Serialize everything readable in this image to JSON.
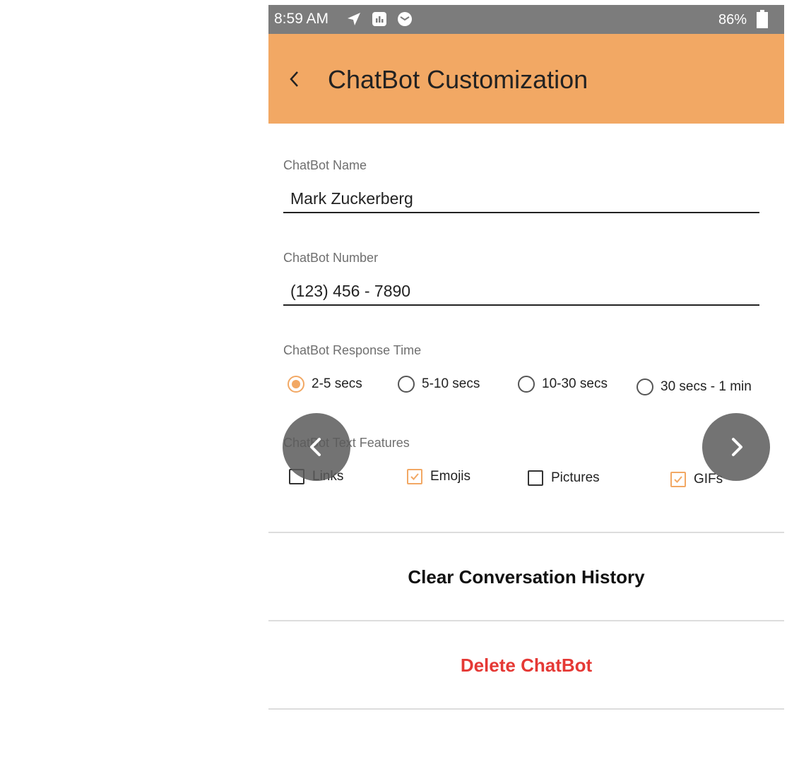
{
  "status_bar": {
    "time": "8:59 AM",
    "battery": "86%"
  },
  "app_bar": {
    "title": "ChatBot Customization",
    "background_color": "#f2a864"
  },
  "form": {
    "name": {
      "label": "ChatBot Name",
      "value": "Mark Zuckerberg"
    },
    "number": {
      "label": "ChatBot Number",
      "value": "(123) 456 - 7890"
    },
    "response_time": {
      "label": "ChatBot Response Time",
      "options": [
        {
          "label": "2-5 secs",
          "selected": true
        },
        {
          "label": "5-10 secs",
          "selected": false
        },
        {
          "label": "10-30 secs",
          "selected": false
        },
        {
          "label": "30 secs - 1 min",
          "selected": false
        }
      ]
    },
    "text_features": {
      "label": "ChatBot Text Features",
      "options": [
        {
          "label": "Links",
          "checked": false
        },
        {
          "label": "Emojis",
          "checked": true
        },
        {
          "label": "Pictures",
          "checked": false
        },
        {
          "label": "GIFs",
          "checked": true
        }
      ]
    }
  },
  "actions": {
    "clear_history": "Clear Conversation History",
    "delete_chatbot": "Delete ChatBot",
    "delete_color": "#e53935"
  },
  "icons": {
    "status": [
      "send-icon",
      "app-icon",
      "mail-icon",
      "battery-icon"
    ],
    "nav": [
      "back-arrow-icon",
      "chevron-left-icon",
      "chevron-right-icon"
    ]
  }
}
